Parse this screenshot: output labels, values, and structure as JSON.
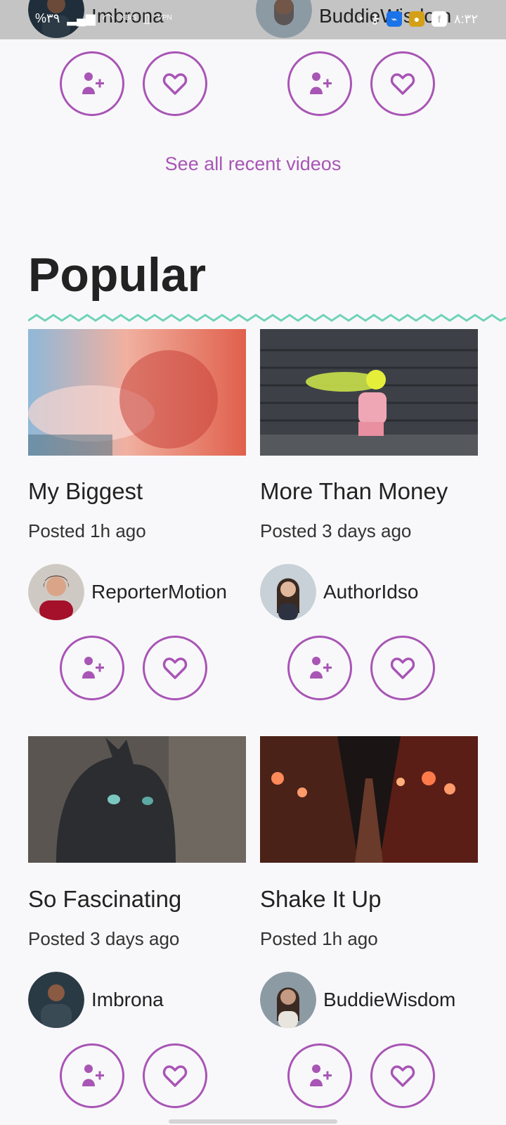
{
  "status_bar": {
    "battery_text": "%۳۹",
    "net_speed": "KB/S",
    "vpn_label": "VPN",
    "time": "۸:۳۲"
  },
  "top_authors": [
    {
      "name": "Imbrona"
    },
    {
      "name": "BuddieWisdom"
    }
  ],
  "see_all_link": "See all recent videos",
  "section_title": "Popular",
  "cards": [
    {
      "title": "My Biggest",
      "posted": "Posted 1h ago",
      "author": "ReporterMotion"
    },
    {
      "title": "More Than Money",
      "posted": "Posted 3 days ago",
      "author": "AuthorIdso"
    },
    {
      "title": "So Fascinating",
      "posted": "Posted 3 days ago",
      "author": "Imbrona"
    },
    {
      "title": "Shake It Up",
      "posted": "Posted 1h ago",
      "author": "BuddieWisdom"
    }
  ],
  "colors": {
    "accent": "#a855b5",
    "zigzag": "#6fd3b6",
    "background": "#f8f8fa"
  },
  "icons": {
    "follow": "add-user-icon",
    "like": "heart-icon"
  }
}
